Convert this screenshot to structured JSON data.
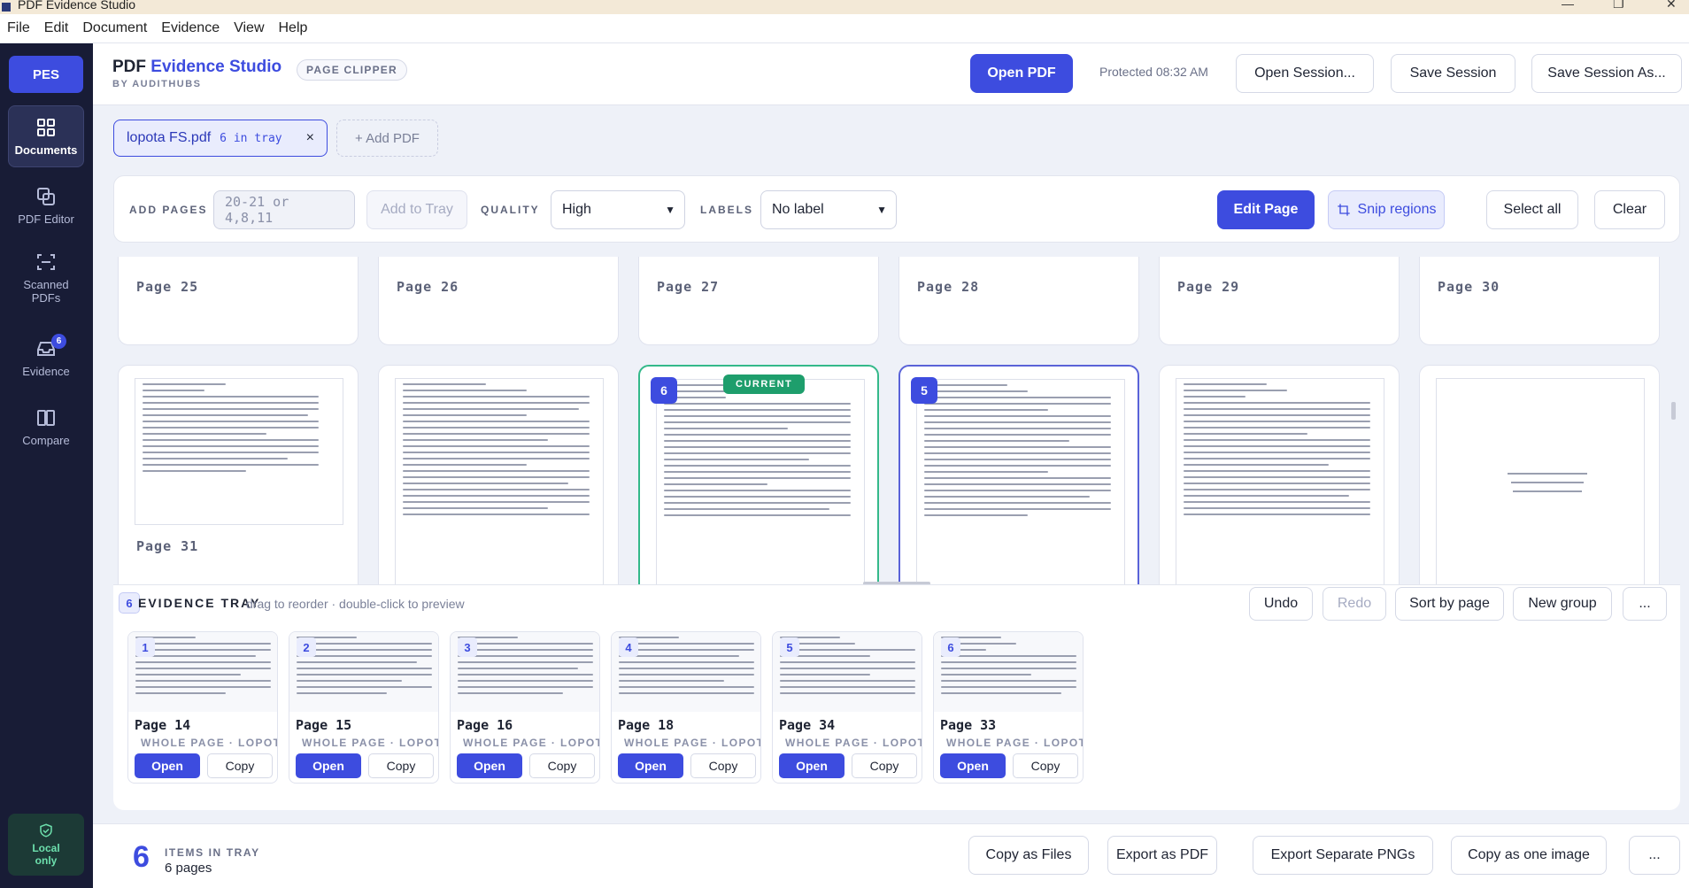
{
  "window": {
    "title": "PDF Evidence Studio",
    "controls": [
      "—",
      "❐",
      "✕"
    ]
  },
  "menu": [
    "File",
    "Edit",
    "Document",
    "Evidence",
    "View",
    "Help"
  ],
  "sidebar": {
    "logo": "PES",
    "items": [
      {
        "label": "Documents",
        "icon": "grid-icon",
        "active": true
      },
      {
        "label": "PDF Editor",
        "icon": "edit-icon"
      },
      {
        "label": "Scanned PDFs",
        "icon": "scan-icon"
      },
      {
        "label": "Evidence",
        "icon": "tray-icon",
        "badge": "6"
      },
      {
        "label": "Compare",
        "icon": "columns-icon"
      }
    ],
    "local": "Local only"
  },
  "header": {
    "brand_plain": "PDF ",
    "brand_accent": "Evidence Studio",
    "brand_sub": "BY AUDITHUBS",
    "tag": "PAGE CLIPPER",
    "open_pdf": "Open PDF",
    "protected": "Protected 08:32 AM",
    "open_session": "Open Session...",
    "save_session": "Save Session",
    "save_session_as": "Save Session As..."
  },
  "docs": {
    "chip_name": "lopota FS.pdf",
    "chip_count": "6 in tray",
    "chip_close": "×",
    "add_pdf": "+ Add PDF"
  },
  "toolbar": {
    "add_pages_label": "ADD PAGES",
    "add_pages_placeholder": "20-21 or 4,8,11",
    "add_to_tray": "Add to Tray",
    "quality_label": "QUALITY",
    "quality_value": "High",
    "labels_label": "LABELS",
    "labels_value": "No label",
    "edit_page": "Edit Page",
    "snip_regions": "Snip regions",
    "select_all": "Select all",
    "clear": "Clear"
  },
  "grid": {
    "row1": [
      "Page 25",
      "Page 26",
      "Page 27",
      "Page 28",
      "Page 29",
      "Page 30"
    ],
    "row2": [
      {
        "label": "Page 31"
      },
      {
        "label": ""
      },
      {
        "label": "",
        "tray_num": "6",
        "current": "CURRENT"
      },
      {
        "label": "",
        "tray_num": "5"
      },
      {
        "label": ""
      },
      {
        "label": ""
      }
    ]
  },
  "tray": {
    "count_badge": "6",
    "title": "EVIDENCE TRAY",
    "hint": "drag to reorder · double-click to preview",
    "undo": "Undo",
    "redo": "Redo",
    "sort": "Sort by page",
    "new_group": "New group",
    "more": "...",
    "items": [
      {
        "num": "1",
        "page": "Page 14",
        "sub": "WHOLE PAGE · LOPOT...",
        "open": "Open",
        "copy": "Copy"
      },
      {
        "num": "2",
        "page": "Page 15",
        "sub": "WHOLE PAGE · LOPOT...",
        "open": "Open",
        "copy": "Copy"
      },
      {
        "num": "3",
        "page": "Page 16",
        "sub": "WHOLE PAGE · LOPOT...",
        "open": "Open",
        "copy": "Copy"
      },
      {
        "num": "4",
        "page": "Page 18",
        "sub": "WHOLE PAGE · LOPOT...",
        "open": "Open",
        "copy": "Copy"
      },
      {
        "num": "5",
        "page": "Page 34",
        "sub": "WHOLE PAGE · LOPOT...",
        "open": "Open",
        "copy": "Copy"
      },
      {
        "num": "6",
        "page": "Page 33",
        "sub": "WHOLE PAGE · LOPOT...",
        "open": "Open",
        "copy": "Copy"
      }
    ]
  },
  "footer": {
    "count": "6",
    "items_label": "ITEMS IN TRAY",
    "pages": "6 pages",
    "copy_files": "Copy as Files",
    "export_pdf": "Export as PDF",
    "export_png": "Export Separate PNGs",
    "copy_image": "Copy as one image",
    "more": "..."
  },
  "colors": {
    "accent": "#3d4cdf",
    "sidebar": "#181c36",
    "current": "#1e9e6c"
  }
}
